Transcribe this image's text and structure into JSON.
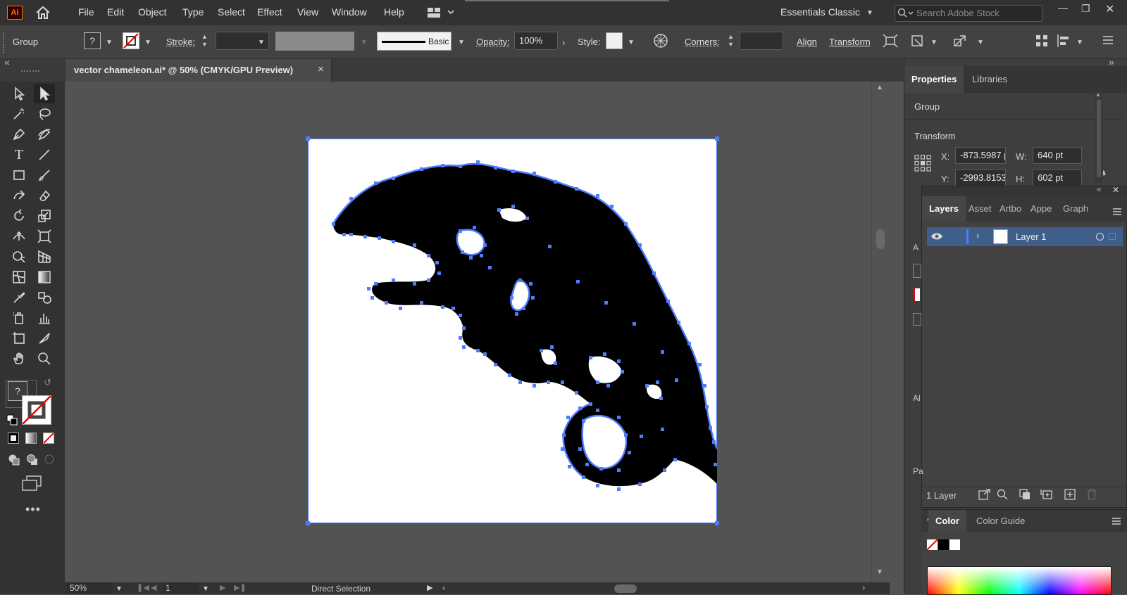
{
  "menubar": {
    "app_logo": "Ai",
    "items": [
      "File",
      "Edit",
      "Object",
      "Type",
      "Select",
      "Effect",
      "View",
      "Window",
      "Help"
    ],
    "workspace": "Essentials Classic",
    "search_placeholder": "Search Adobe Stock"
  },
  "controlbar": {
    "selection_label": "Group",
    "fill_value": "?",
    "stroke_label": "Stroke:",
    "brush_label": "Basic",
    "opacity_label": "Opacity:",
    "opacity_value": "100%",
    "style_label": "Style:",
    "corners_label": "Corners:",
    "align_label": "Align",
    "transform_label": "Transform"
  },
  "document": {
    "tab_title": "vector chameleon.ai* @ 50% (CMYK/GPU Preview)",
    "close_glyph": "×"
  },
  "statusbar": {
    "zoom": "50%",
    "artboard_number": "1",
    "tool_name": "Direct Selection"
  },
  "properties": {
    "tabs": [
      "Properties",
      "Libraries"
    ],
    "selection_type": "Group",
    "transform_title": "Transform",
    "x_label": "X:",
    "x_value": "-873.5987 p",
    "y_label": "Y:",
    "y_value": "-2993.8153",
    "w_label": "W:",
    "w_value": "640 pt",
    "h_label": "H:",
    "h_value": "602 pt"
  },
  "layers": {
    "tabs": [
      "Layers",
      "Asset",
      "Artbo",
      "Appe",
      "Graph"
    ],
    "layer_name": "Layer 1",
    "layer_count": "1 Layer"
  },
  "color_panel": {
    "tabs": [
      "Color",
      "Color Guide"
    ]
  },
  "colors": {
    "selection_blue": "#4f7cff",
    "layer_highlight": "#3f5f8a"
  }
}
